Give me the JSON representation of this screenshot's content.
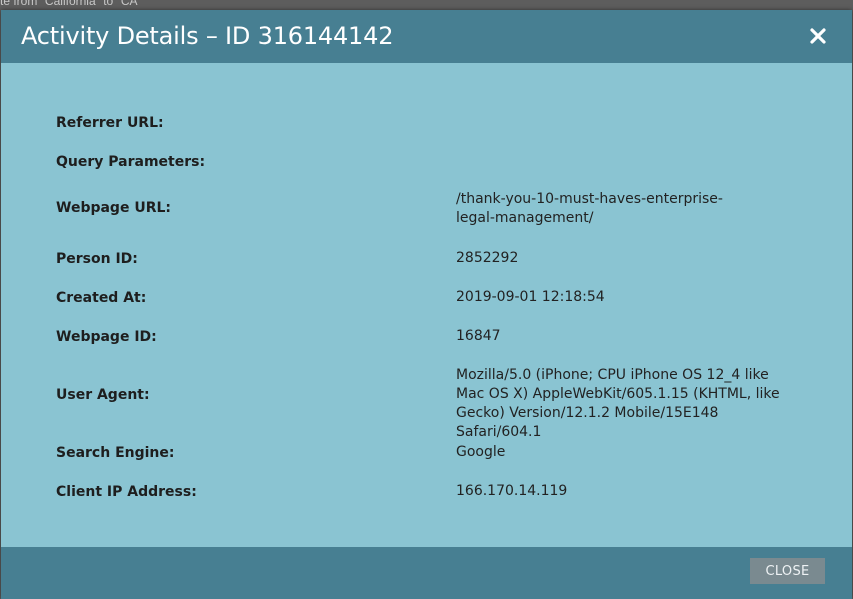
{
  "backdrop": {
    "text": "te from \"California\" to \"CA\""
  },
  "modal": {
    "title": "Activity Details – ID 316144142",
    "close_icon": "close-icon",
    "fields": [
      {
        "label": "Referrer URL:",
        "value": ""
      },
      {
        "label": "Query Parameters:",
        "value": ""
      },
      {
        "label": "Webpage URL:",
        "value": "/thank-you-10-must-haves-enterprise-legal-management/"
      },
      {
        "label": "Person ID:",
        "value": "2852292"
      },
      {
        "label": "Created At:",
        "value": "2019-09-01 12:18:54"
      },
      {
        "label": "Webpage ID:",
        "value": "16847"
      },
      {
        "label": "User Agent:",
        "value": "Mozilla/5.0 (iPhone; CPU iPhone OS 12_4 like Mac OS X) AppleWebKit/605.1.15 (KHTML, like Gecko) Version/12.1.2 Mobile/15E148 Safari/604.1"
      },
      {
        "label": "Search Engine:",
        "value": "Google"
      },
      {
        "label": "Client IP Address:",
        "value": "166.170.14.119"
      }
    ],
    "close_button_label": "CLOSE"
  },
  "colors": {
    "header": "#477f92",
    "body": "#8ac4d2",
    "button": "#7a8a90"
  }
}
